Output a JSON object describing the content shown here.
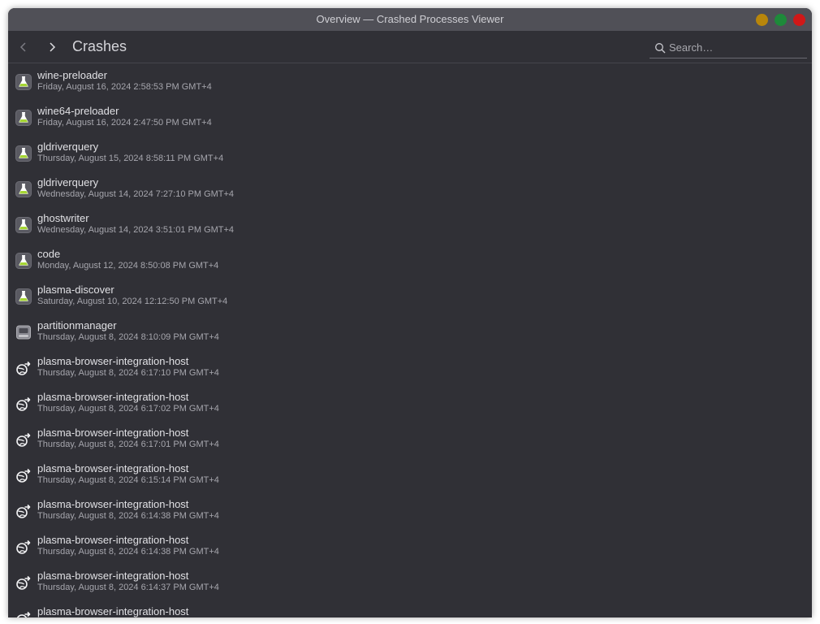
{
  "window": {
    "title": "Overview — Crashed Processes Viewer"
  },
  "toolbar": {
    "page_title": "Crashes",
    "search_placeholder": "Search…"
  },
  "colors": {
    "background": "#303036",
    "titlebar": "#505057",
    "minimize": "#b8860b",
    "maximize": "#1e8a3a",
    "close": "#d01818"
  },
  "crashes": [
    {
      "name": "wine-preloader",
      "date": "Friday, August 16, 2024 2:58:53 PM GMT+4",
      "icon": "flask-icon"
    },
    {
      "name": "wine64-preloader",
      "date": "Friday, August 16, 2024 2:47:50 PM GMT+4",
      "icon": "flask-icon"
    },
    {
      "name": "gldriverquery",
      "date": "Thursday, August 15, 2024 8:58:11 PM GMT+4",
      "icon": "flask-icon"
    },
    {
      "name": "gldriverquery",
      "date": "Wednesday, August 14, 2024 7:27:10 PM GMT+4",
      "icon": "flask-icon"
    },
    {
      "name": "ghostwriter",
      "date": "Wednesday, August 14, 2024 3:51:01 PM GMT+4",
      "icon": "flask-icon"
    },
    {
      "name": "code",
      "date": "Monday, August 12, 2024 8:50:08 PM GMT+4",
      "icon": "flask-icon"
    },
    {
      "name": "plasma-discover",
      "date": "Saturday, August 10, 2024 12:12:50 PM GMT+4",
      "icon": "flask-icon"
    },
    {
      "name": "partitionmanager",
      "date": "Thursday, August 8, 2024 8:10:09 PM GMT+4",
      "icon": "disk-icon"
    },
    {
      "name": "plasma-browser-integration-host",
      "date": "Thursday, August 8, 2024 6:17:10 PM GMT+4",
      "icon": "browser-integration-icon"
    },
    {
      "name": "plasma-browser-integration-host",
      "date": "Thursday, August 8, 2024 6:17:02 PM GMT+4",
      "icon": "browser-integration-icon"
    },
    {
      "name": "plasma-browser-integration-host",
      "date": "Thursday, August 8, 2024 6:17:01 PM GMT+4",
      "icon": "browser-integration-icon"
    },
    {
      "name": "plasma-browser-integration-host",
      "date": "Thursday, August 8, 2024 6:15:14 PM GMT+4",
      "icon": "browser-integration-icon"
    },
    {
      "name": "plasma-browser-integration-host",
      "date": "Thursday, August 8, 2024 6:14:38 PM GMT+4",
      "icon": "browser-integration-icon"
    },
    {
      "name": "plasma-browser-integration-host",
      "date": "Thursday, August 8, 2024 6:14:38 PM GMT+4",
      "icon": "browser-integration-icon"
    },
    {
      "name": "plasma-browser-integration-host",
      "date": "Thursday, August 8, 2024 6:14:37 PM GMT+4",
      "icon": "browser-integration-icon"
    },
    {
      "name": "plasma-browser-integration-host",
      "date": "",
      "icon": "browser-integration-icon"
    }
  ]
}
